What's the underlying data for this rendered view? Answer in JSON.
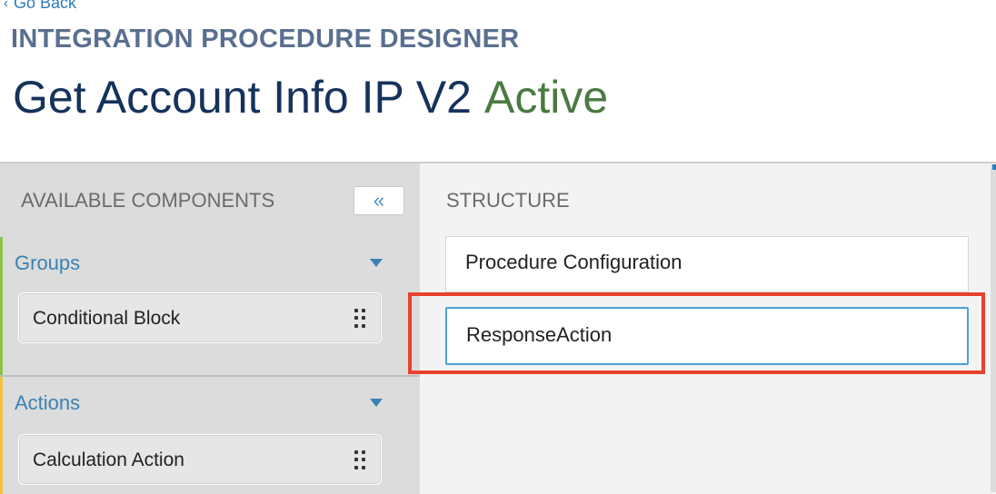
{
  "nav": {
    "go_back": "Go Back"
  },
  "header": {
    "designer_label": "INTEGRATION PROCEDURE DESIGNER",
    "procedure_name": "Get Account Info IP V2",
    "status": "Active"
  },
  "left_panel": {
    "title": "AVAILABLE COMPONENTS",
    "collapse_symbol": "«",
    "groups": [
      {
        "title": "Groups",
        "accent": "#8bc34a",
        "items": [
          {
            "label": "Conditional Block"
          }
        ]
      },
      {
        "title": "Actions",
        "accent": "#f0c040",
        "items": [
          {
            "label": "Calculation Action"
          }
        ]
      }
    ]
  },
  "structure": {
    "title": "STRUCTURE",
    "items": [
      {
        "label": "Procedure Configuration",
        "selected": false
      },
      {
        "label": "ResponseAction",
        "selected": true
      }
    ]
  },
  "colors": {
    "title": "#16325c",
    "active_status": "#4a7a40",
    "link": "#2f7cb8",
    "highlight": "#e8412c",
    "selected_border": "#4aa0d6"
  }
}
